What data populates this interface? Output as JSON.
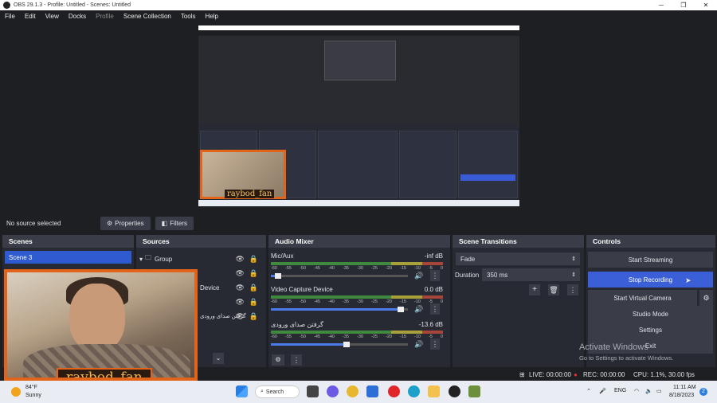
{
  "window": {
    "title": "OBS 29.1.3 - Profile: Untitled - Scenes: Untitled"
  },
  "menu": [
    "File",
    "Edit",
    "View",
    "Docks",
    "Profile",
    "Scene Collection",
    "Tools",
    "Help"
  ],
  "toolbar": {
    "no_source": "No source selected",
    "properties": "Properties",
    "filters": "Filters"
  },
  "scenes": {
    "header": "Scenes",
    "items": [
      "Scene 3"
    ]
  },
  "sources": {
    "header": "Sources",
    "items": [
      "Group",
      "",
      "Device",
      "",
      "گرفتن صدای ورودی"
    ]
  },
  "mixer": {
    "header": "Audio Mixer",
    "scale": [
      "-60",
      "-55",
      "-50",
      "-45",
      "-40",
      "-35",
      "-30",
      "-25",
      "-20",
      "-15",
      "-10",
      "-5",
      "0"
    ],
    "channels": [
      {
        "name": "Mic/Aux",
        "db": "-inf dB",
        "fill": 0.05
      },
      {
        "name": "Video Capture Device",
        "db": "0.0 dB",
        "fill": 0.95
      },
      {
        "name": "گرفتن صدای ورودی",
        "db": "-13.6 dB",
        "fill": 0.55
      }
    ]
  },
  "transitions": {
    "header": "Scene Transitions",
    "type": "Fade",
    "duration_label": "Duration",
    "duration": "350 ms"
  },
  "controls": {
    "header": "Controls",
    "start_streaming": "Start Streaming",
    "stop_recording": "Stop Recording",
    "start_virtual_camera": "Start Virtual Camera",
    "studio_mode": "Studio Mode",
    "settings": "Settings",
    "exit": "Exit"
  },
  "status": {
    "live": "LIVE: 00:00:00",
    "rec": "REC: 00:00:00",
    "cpu": "CPU: 1.1%, 30.00 fps"
  },
  "webcam": {
    "label": "raybod_fan"
  },
  "watermark": {
    "line1": "Activate Windows",
    "line2": "Go to Settings to activate Windows."
  },
  "taskbar": {
    "temp": "84°F",
    "weather": "Sunny",
    "search": "Search",
    "lang": "ENG",
    "time": "11:11 AM",
    "date": "8/18/2023"
  },
  "colors": {
    "accent": "#3a5fd6",
    "frame": "#e2641a"
  }
}
